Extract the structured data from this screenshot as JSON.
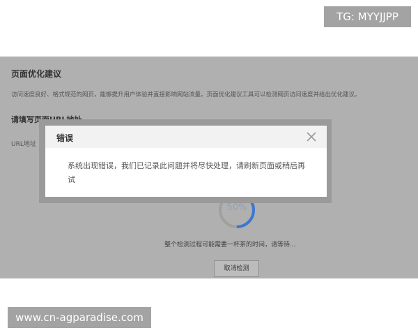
{
  "badge": {
    "text": "TG: MYYJJPP"
  },
  "page": {
    "title": "页面优化建议",
    "description": "访问速度良好、格式规范的网页，能够提升用户体验并直接影响网站流量。页面优化建议工具可以检测网页访问速度并给出优化建议。",
    "url_section_title": "请填写页面URL地址",
    "url_label": "URL地址",
    "progress_text": "50%",
    "progress_value": 0.5,
    "wait_text": "整个检测过程可能需要一杯茶的时间，请等待...",
    "cancel_label": "取消检测"
  },
  "dialog": {
    "title": "错误",
    "message": "系统出现错误，我们已记录此问题并将尽快处理，请刷新页面或稍后再试",
    "close_icon": "close-icon"
  },
  "watermark": {
    "text": "www.cn-agparadise.com"
  },
  "colors": {
    "overlay": "#b0b0b0",
    "accent": "#3b78d0",
    "dialog_header": "#f2f2f2"
  }
}
